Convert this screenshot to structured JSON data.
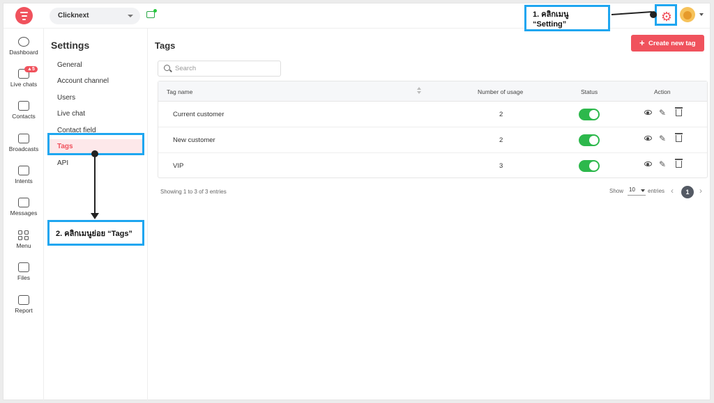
{
  "workspace": "Clicknext",
  "rail": [
    {
      "label": "Dashboard",
      "icon": "dashboard-icon"
    },
    {
      "label": "Live chats",
      "icon": "chat-icon",
      "badge": "5"
    },
    {
      "label": "Contacts",
      "icon": "contacts-icon"
    },
    {
      "label": "Broadcasts",
      "icon": "megaphone-icon"
    },
    {
      "label": "Intents",
      "icon": "intents-icon"
    },
    {
      "label": "Messages",
      "icon": "messages-icon"
    },
    {
      "label": "Menu",
      "icon": "menu-grid-icon"
    },
    {
      "label": "Files",
      "icon": "folder-icon"
    },
    {
      "label": "Report",
      "icon": "report-icon"
    }
  ],
  "settings": {
    "title": "Settings",
    "items": [
      "General",
      "Account channel",
      "Users",
      "Live chat",
      "Contact field",
      "Tags",
      "API"
    ],
    "active": "Tags"
  },
  "main": {
    "title": "Tags",
    "create_button": "Create new tag",
    "search_placeholder": "Search",
    "columns": [
      "Tag name",
      "Number of usage",
      "Status",
      "Action"
    ],
    "rows": [
      {
        "name": "Current customer",
        "usage": "2",
        "status": true
      },
      {
        "name": "New customer",
        "usage": "2",
        "status": true
      },
      {
        "name": "VIP",
        "usage": "3",
        "status": true
      }
    ],
    "footer": {
      "showing": "Showing 1 to 3 of 3 entries",
      "show_label": "Show",
      "page_size": "10",
      "entries_label": "entries",
      "current_page": "1"
    }
  },
  "annotations": {
    "step1": "1. คลิกเมนู “Setting”",
    "step2": "2. คลิกเมนูย่อย “Tags”"
  },
  "colors": {
    "accent": "#f0525d",
    "toggle_on": "#2db84c",
    "callout_border": "#1ea6f0"
  }
}
